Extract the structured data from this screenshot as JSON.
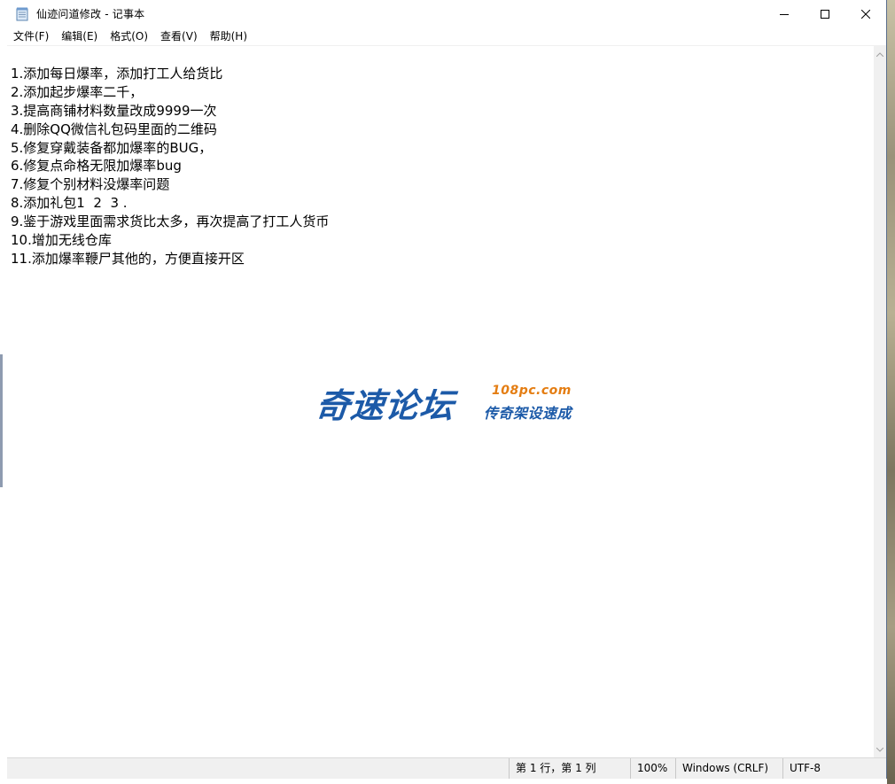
{
  "window": {
    "title": "仙迹问道修改 - 记事本"
  },
  "menu": [
    {
      "label": "文件(F)"
    },
    {
      "label": "编辑(E)"
    },
    {
      "label": "格式(O)"
    },
    {
      "label": "查看(V)"
    },
    {
      "label": "帮助(H)"
    }
  ],
  "editor": {
    "lines": [
      "1.添加每日爆率，添加打工人给货比",
      "2.添加起步爆率二千，",
      "3.提高商铺材料数量改成9999一次",
      "4.删除QQ微信礼包码里面的二维码",
      "5.修复穿戴装备都加爆率的BUG，",
      "6.修复点命格无限加爆率bug",
      "7.修复个别材料没爆率问题",
      "8.添加礼包1  2  3 .",
      "9.鉴于游戏里面需求货比太多，再次提高了打工人货币",
      "10.增加无线仓库",
      "11.添加爆率鞭尸其他的，方便直接开区"
    ]
  },
  "watermark": {
    "main": "奇速论坛",
    "url": "108pc.com",
    "sub": "传奇架设速成"
  },
  "statusbar": {
    "position": "第 1 行，第 1 列",
    "zoom": "100%",
    "line_ending": "Windows (CRLF)",
    "encoding": "UTF-8"
  },
  "colors": {
    "watermark_blue": "#1c5aa8",
    "watermark_orange": "#e47d12"
  }
}
